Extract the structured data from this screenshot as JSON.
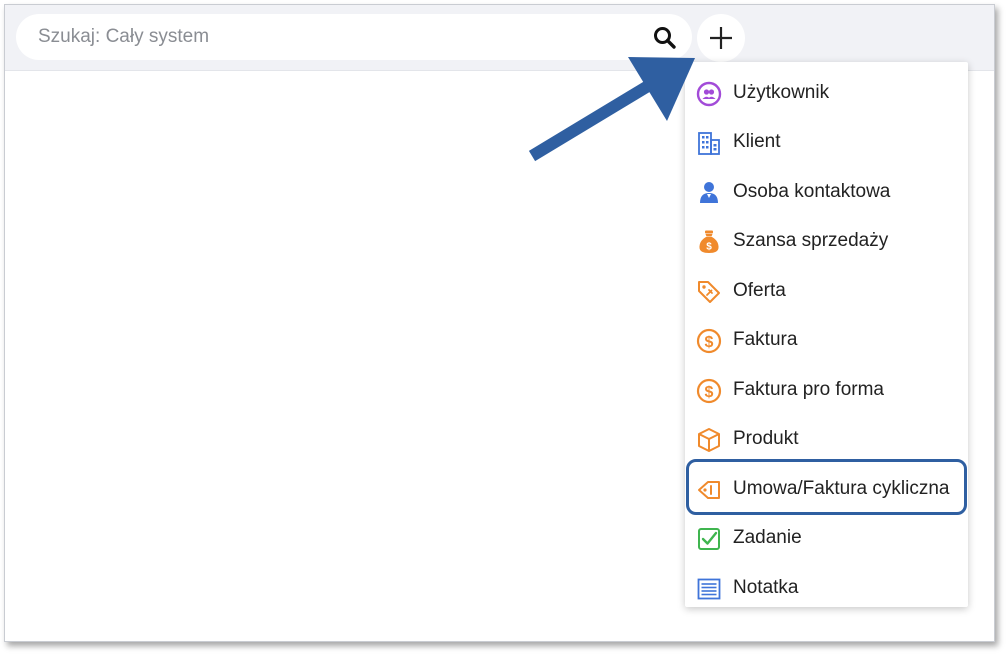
{
  "search": {
    "placeholder": "Szukaj: Cały system"
  },
  "add_button": {
    "icon": "plus-icon"
  },
  "menu": {
    "items": [
      {
        "label": "Użytkownik",
        "icon": "user-circle-icon",
        "color": "#a24bd8"
      },
      {
        "label": "Klient",
        "icon": "building-icon",
        "color": "#3f74d9"
      },
      {
        "label": "Osoba kontaktowa",
        "icon": "contact-person-icon",
        "color": "#3f74d9"
      },
      {
        "label": "Szansa sprzedaży",
        "icon": "money-bag-icon",
        "color": "#f08a2c"
      },
      {
        "label": "Oferta",
        "icon": "price-tag-icon",
        "color": "#f08a2c"
      },
      {
        "label": "Faktura",
        "icon": "dollar-circle-icon",
        "color": "#f08a2c"
      },
      {
        "label": "Faktura pro forma",
        "icon": "dollar-circle-icon",
        "color": "#f08a2c"
      },
      {
        "label": "Produkt",
        "icon": "box-icon",
        "color": "#f08a2c"
      },
      {
        "label": "Umowa/Faktura cykliczna",
        "icon": "tag-icon",
        "color": "#f08a2c"
      },
      {
        "label": "Zadanie",
        "icon": "checkbox-icon",
        "color": "#3fb54f"
      },
      {
        "label": "Notatka",
        "icon": "note-icon",
        "color": "#3f74d9"
      }
    ],
    "highlighted_index": 8
  },
  "colors": {
    "annotation": "#2f5fa1",
    "topbar": "#f1f2f6"
  }
}
